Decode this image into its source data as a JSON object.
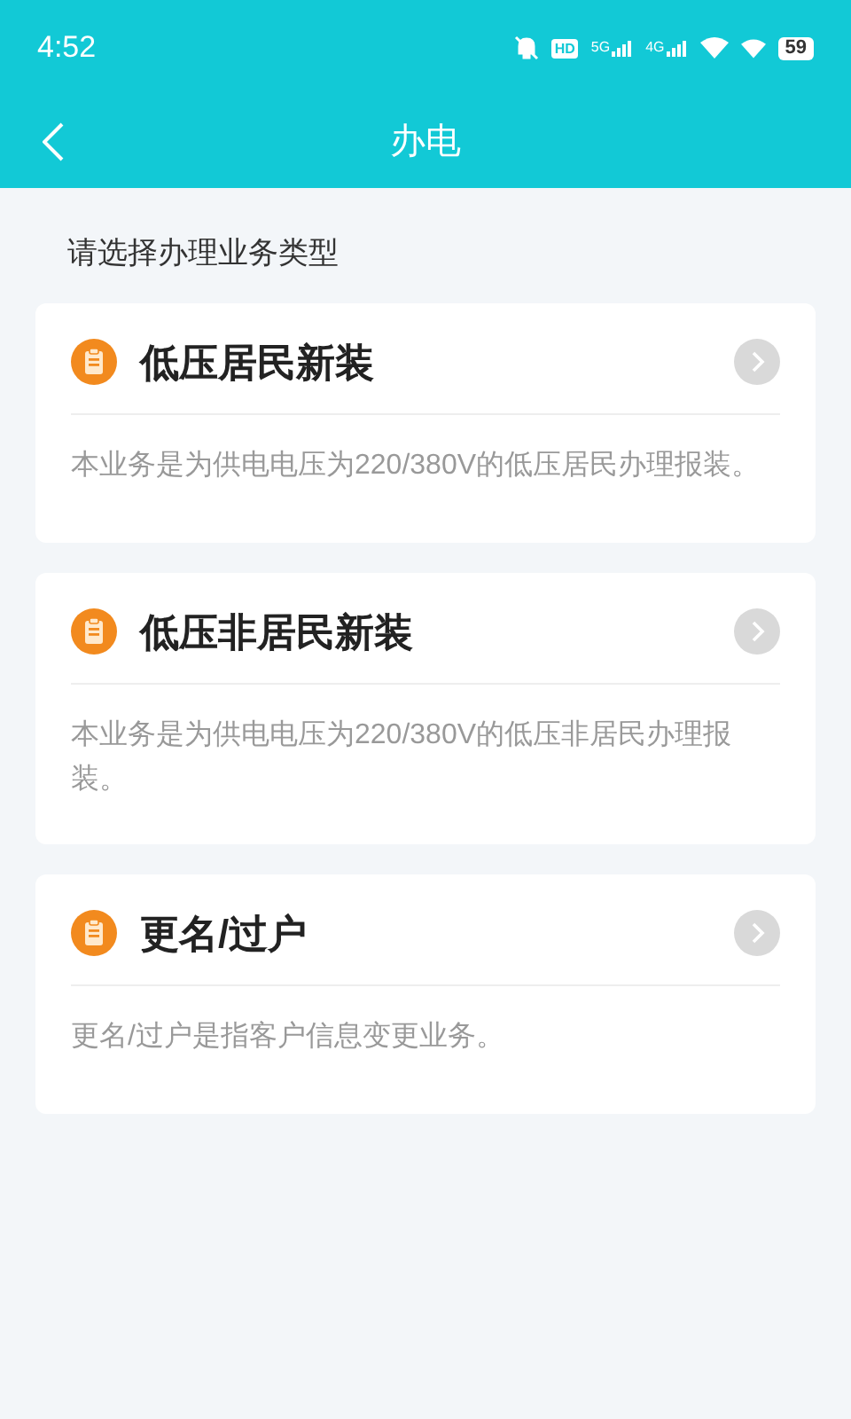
{
  "status_bar": {
    "time": "4:52",
    "hd_label": "HD",
    "network_1": "5G",
    "network_2": "4G",
    "battery": "59"
  },
  "header": {
    "title": "办电"
  },
  "prompt": "请选择办理业务类型",
  "services": [
    {
      "title": "低压居民新装",
      "description": "本业务是为供电电压为220/380V的低压居民办理报装。"
    },
    {
      "title": "低压非居民新装",
      "description": "本业务是为供电电压为220/380V的低压非居民办理报装。"
    },
    {
      "title": "更名/过户",
      "description": "更名/过户是指客户信息变更业务。"
    }
  ]
}
